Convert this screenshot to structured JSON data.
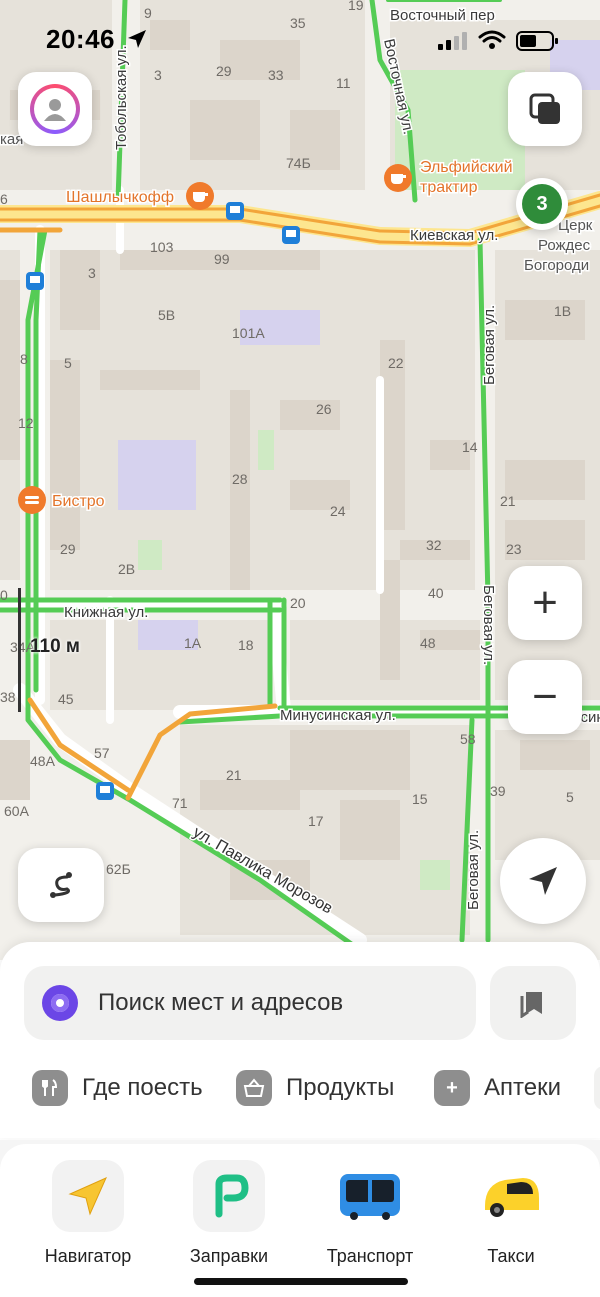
{
  "status_bar": {
    "time": "20:46"
  },
  "map": {
    "streets": {
      "kievskaya": "Киевская ул.",
      "tobolskaya": "Тобольская ул.",
      "vostochnaya": "Восточная ул.",
      "vostochny_per": "Восточный пер",
      "begovaya_1": "Беговая ул.",
      "begovaya_2": "Беговая ул.",
      "begovaya_3": "Беговая ул.",
      "knizhnaya": "Книжная ул.",
      "minusinskaya": "Минусинская ул.",
      "minusinskaya_edge": "Минусин",
      "pavlika": "ул. Павлика Морозов"
    },
    "pois": {
      "shashlychkoff": "Шашлычкофф",
      "elfiysky_1": "Эльфийский",
      "elfiysky_2": "трактир",
      "bistro": "Бистро"
    },
    "edge_labels": {
      "kaya": "кая",
      "church_1": "Церк",
      "church_2": "Рождес",
      "church_3": "Богороди"
    },
    "house_numbers": {
      "h9": "9",
      "h19": "19",
      "h35": "35",
      "h3a": "3",
      "h29": "29",
      "h33": "33",
      "h11": "11",
      "h74b": "74Б",
      "h6": "6",
      "h103": "103",
      "h99": "99",
      "h3b": "3",
      "h5v": "5В",
      "h101a": "101А",
      "h1v": "1В",
      "h8": "8",
      "h5": "5",
      "h22": "22",
      "h12": "12",
      "h26": "26",
      "h14": "14",
      "h28": "28",
      "h24": "24",
      "h21a": "21",
      "h32": "32",
      "h23": "23",
      "h29b": "29",
      "h2v": "2В",
      "h20": "20",
      "h40": "40",
      "h34a": "34А",
      "h1a": "1А",
      "h18": "18",
      "h48": "48",
      "h38": "38",
      "h45": "45",
      "h58": "58",
      "h57": "57",
      "h48a": "48А",
      "h21b": "21",
      "h39": "39",
      "h60a": "60А",
      "h71": "71",
      "h15": "15",
      "h5b": "5",
      "h17": "17",
      "h62b": "62Б",
      "h0": "0"
    },
    "layers_badge_count": "3",
    "scale_label": "110 м",
    "colors": {
      "traffic_free": "#55cc55",
      "traffic_slow": "#f2a53a",
      "poi_cafe": "#f07a2b"
    }
  },
  "controls": {
    "profile": "avatar",
    "layers_icon": "layers-icon",
    "zoom_in": "+",
    "zoom_out": "−",
    "route_icon": "route-icon",
    "locate_icon": "navigation-arrow-icon"
  },
  "search": {
    "placeholder": "Поиск мест и адресов"
  },
  "categories": [
    {
      "label": "Где поесть",
      "icon": "fork-knife-icon"
    },
    {
      "label": "Продукты",
      "icon": "basket-icon"
    },
    {
      "label": "Аптеки",
      "icon": "plus-icon"
    }
  ],
  "apps": [
    {
      "label": "Навигатор",
      "icon": "navigator-icon"
    },
    {
      "label": "Заправки",
      "icon": "fuel-icon"
    },
    {
      "label": "Транспорт",
      "icon": "bus-icon"
    },
    {
      "label": "Такси",
      "icon": "taxi-icon"
    }
  ]
}
